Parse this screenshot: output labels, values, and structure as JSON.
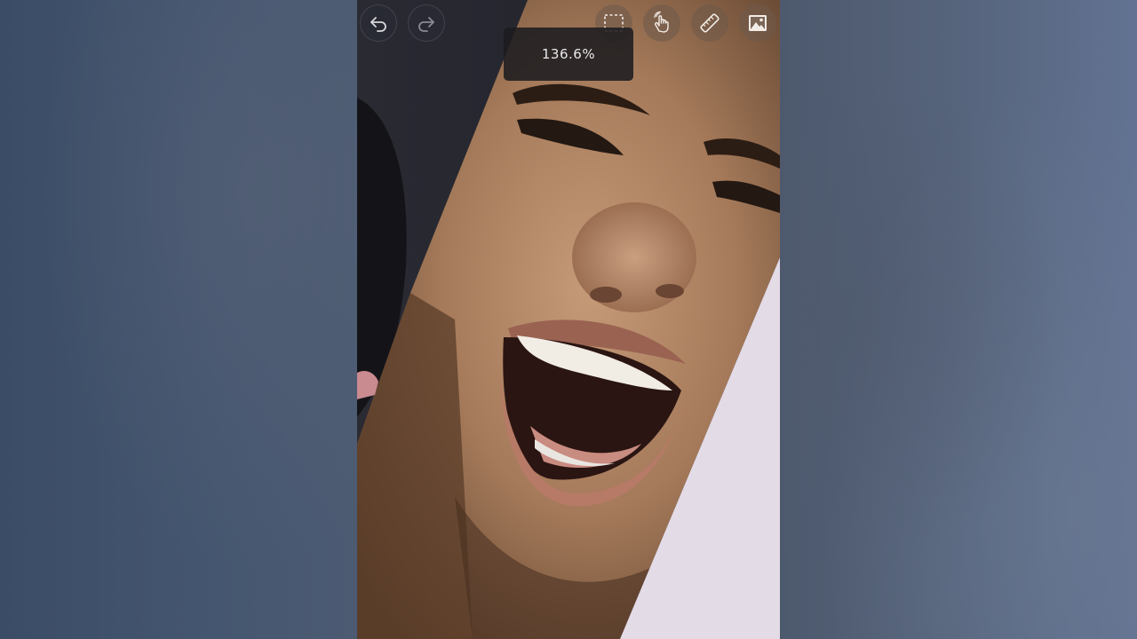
{
  "app": {
    "zoom_level": "136.6%"
  },
  "toolbar": {
    "undo_icon": "undo-icon",
    "redo_icon": "redo-icon",
    "selection_icon": "selection-icon",
    "gesture_icon": "gesture-icon",
    "ruler_icon": "ruler-icon",
    "image_icon": "image-icon"
  },
  "colors": {
    "canvas_light_shape": "#e3dbe6",
    "skin": "#b7896a",
    "toast_bg": "#1c1c20"
  }
}
